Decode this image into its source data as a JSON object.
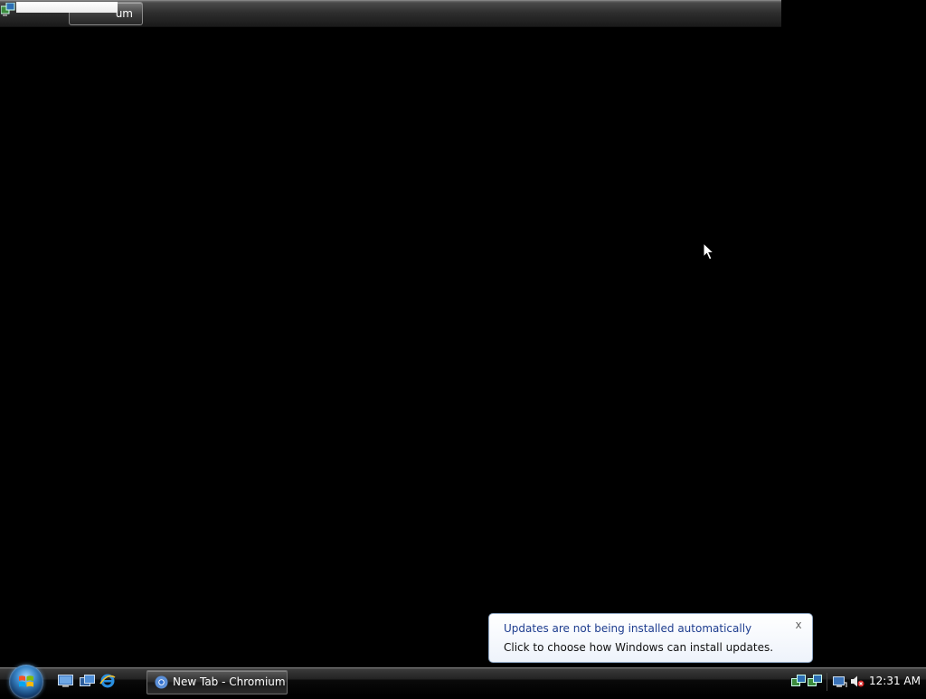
{
  "top_window": {
    "tab_text": "um"
  },
  "notification": {
    "title": "Updates are not being installed automatically",
    "body": "Click to choose how Windows can install updates.",
    "close_glyph": "x",
    "title_color": "#1e3d8f"
  },
  "taskbar": {
    "start_button": "windows-start-orb",
    "quick_launch": [
      "show-desktop-icon",
      "switch-windows-icon",
      "internet-explorer-icon"
    ],
    "task_buttons": [
      {
        "label": "New Tab - Chromium",
        "icon": "chromium-icon"
      }
    ],
    "tray_icons": [
      "network-icon",
      "network-icon",
      "network-connection-icon",
      "volume-muted-icon"
    ],
    "clock": "12:31 AM"
  }
}
